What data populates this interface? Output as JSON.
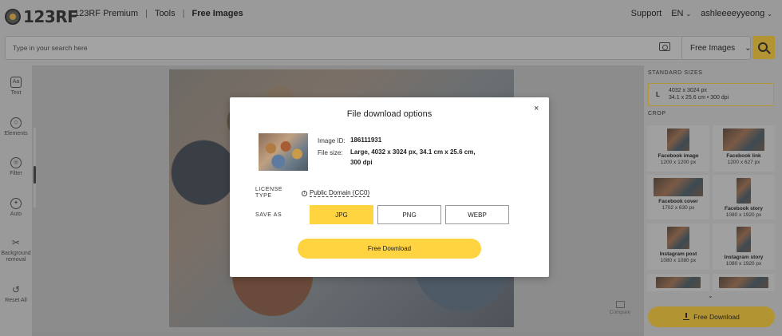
{
  "header": {
    "logo_text": "123RF",
    "nav": [
      "123RF Premium",
      "Tools",
      "Free Images"
    ],
    "nav_separator": "|",
    "support": "Support",
    "language": "EN",
    "username": "ashleeeeyyeong"
  },
  "search": {
    "placeholder": "Type in your search here",
    "scope": "Free Images"
  },
  "tools": [
    {
      "label": "Text",
      "icon": "text-icon",
      "glyph": "Aa"
    },
    {
      "label": "Elements",
      "icon": "shapes-icon",
      "glyph": "◇"
    },
    {
      "label": "Filter",
      "icon": "filter-icon",
      "glyph": "◎"
    },
    {
      "label": "Auto",
      "icon": "auto-icon",
      "glyph": "✦"
    },
    {
      "label": "Background removal",
      "icon": "scissors-icon",
      "glyph": "✂"
    },
    {
      "label": "Reset All",
      "icon": "reset-icon",
      "glyph": "↺"
    }
  ],
  "canvas": {
    "compare_label": "Compare"
  },
  "right_panel": {
    "standard_sizes_title": "STANDARD SIZES",
    "size_card": {
      "letter": "L",
      "dims": "4032 x 3024 px",
      "detail": "34.1 x 25.6 cm • 300 dpi"
    },
    "crop_title": "CROP",
    "crops": [
      {
        "name": "Facebook image",
        "size": "1200 x 1200 px"
      },
      {
        "name": "Facebook link",
        "size": "1200 x 627 px"
      },
      {
        "name": "Facebook cover",
        "size": "1702 x 630 px"
      },
      {
        "name": "Facebook story",
        "size": "1080 x 1920 px"
      },
      {
        "name": "Instagram post",
        "size": "1080 x 1080 px"
      },
      {
        "name": "Instagram story",
        "size": "1080 x 1920 px"
      },
      {
        "name": "",
        "size": ""
      },
      {
        "name": "",
        "size": ""
      }
    ],
    "download_label": "Free Download"
  },
  "modal": {
    "title": "File download options",
    "close_glyph": "×",
    "image_id_label": "Image ID:",
    "image_id": "186111931",
    "file_size_label": "File size:",
    "file_size_line1": "Large, 4032 x 3024 px, 34.1 cm x 25.6 cm,",
    "file_size_line2": "300 dpi",
    "license_label_line1": "LICENSE",
    "license_label_line2": "TYPE",
    "license_value": "Public Domain (CC0)",
    "save_as_label": "SAVE AS",
    "formats": [
      "JPG",
      "PNG",
      "WEBP"
    ],
    "selected_format": "JPG",
    "download_label": "Free Download"
  },
  "colors": {
    "accent_yellow": "#ffd440",
    "dimmed_accent": "#b39433"
  }
}
